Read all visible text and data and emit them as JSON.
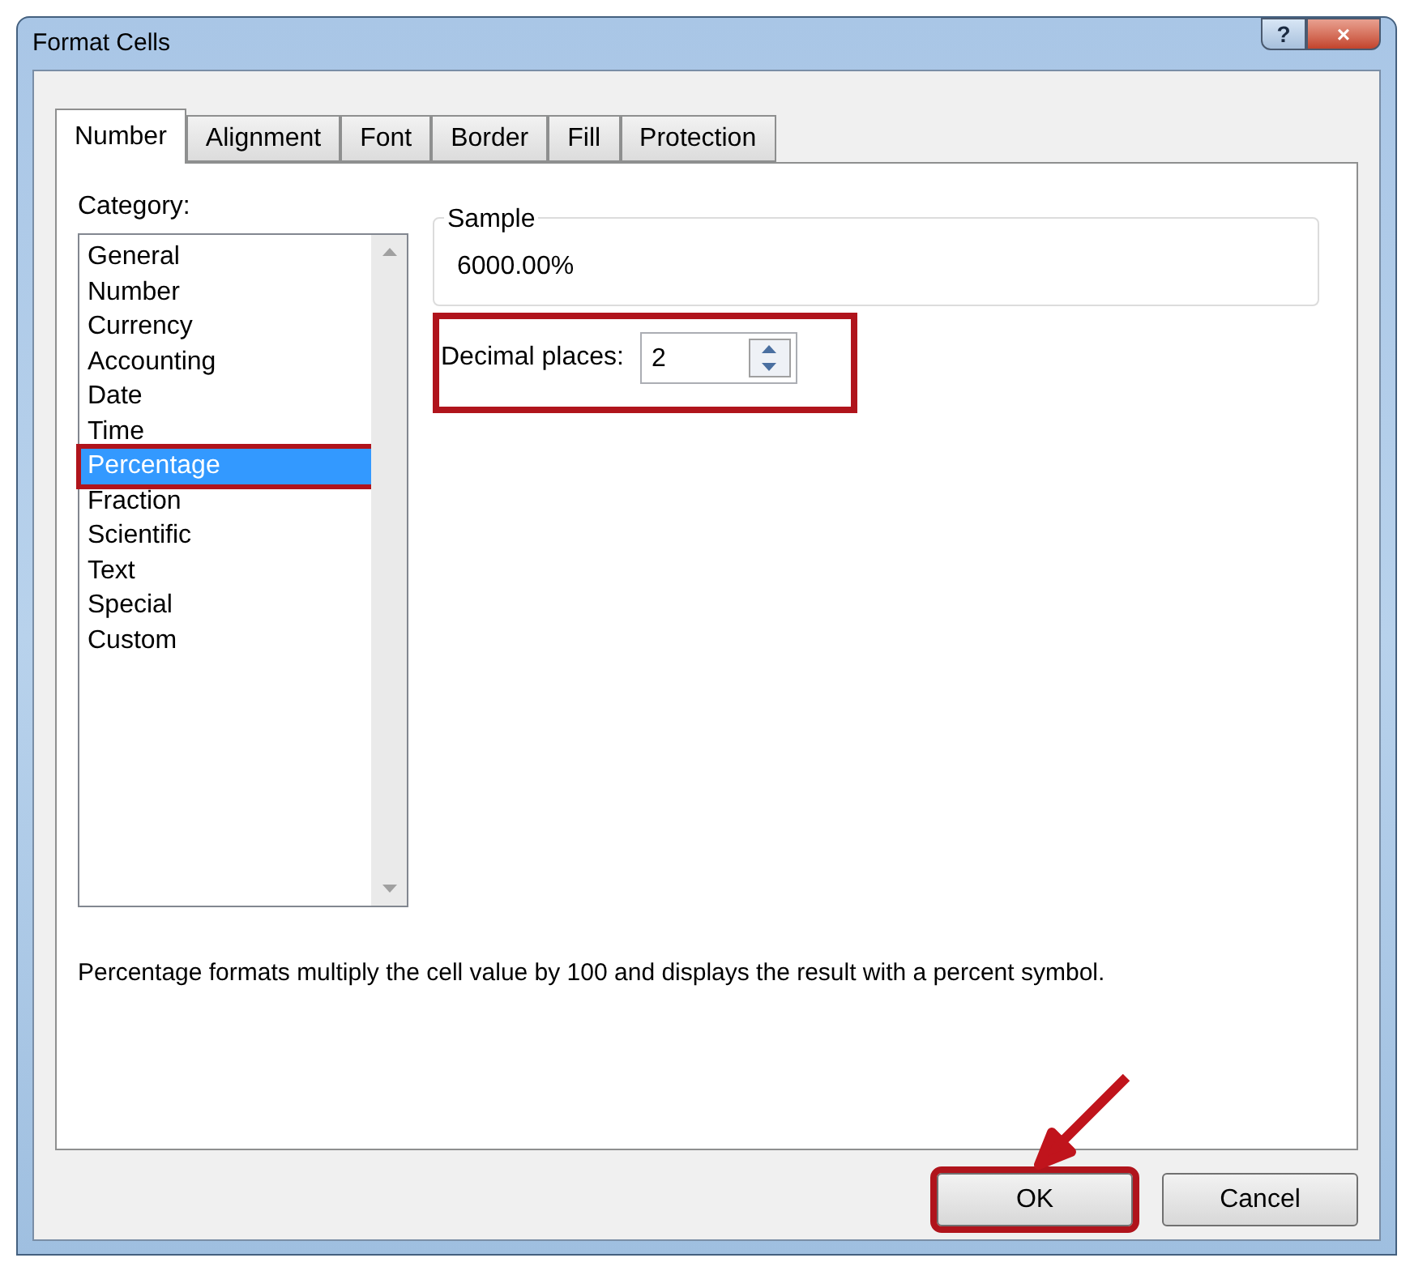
{
  "window": {
    "title": "Format Cells",
    "controls": [
      "?",
      "×"
    ]
  },
  "tabs": [
    {
      "label": "Number",
      "selected": true
    },
    {
      "label": "Alignment",
      "selected": false
    },
    {
      "label": "Font",
      "selected": false
    },
    {
      "label": "Border",
      "selected": false
    },
    {
      "label": "Fill",
      "selected": false
    },
    {
      "label": "Protection",
      "selected": false
    }
  ],
  "category": {
    "label": "Category:",
    "items": [
      {
        "label": "General",
        "selected": false,
        "highlighted": false
      },
      {
        "label": "Number",
        "selected": false,
        "highlighted": false
      },
      {
        "label": "Currency",
        "selected": false,
        "highlighted": false
      },
      {
        "label": "Accounting",
        "selected": false,
        "highlighted": false
      },
      {
        "label": "Date",
        "selected": false,
        "highlighted": false
      },
      {
        "label": "Time",
        "selected": false,
        "highlighted": false
      },
      {
        "label": "Percentage",
        "selected": true,
        "highlighted": true
      },
      {
        "label": "Fraction",
        "selected": false,
        "highlighted": false
      },
      {
        "label": "Scientific",
        "selected": false,
        "highlighted": false
      },
      {
        "label": "Text",
        "selected": false,
        "highlighted": false
      },
      {
        "label": "Special",
        "selected": false,
        "highlighted": false
      },
      {
        "label": "Custom",
        "selected": false,
        "highlighted": false
      }
    ]
  },
  "sample": {
    "label": "Sample",
    "value": "6000.00%"
  },
  "decimal_places": {
    "label": "Decimal places:",
    "value": "2",
    "highlighted": true
  },
  "description": "Percentage formats multiply the cell value by 100 and displays the result with a percent symbol.",
  "buttons": [
    {
      "label": "OK",
      "highlighted": true
    },
    {
      "label": "Cancel",
      "highlighted": false
    }
  ]
}
